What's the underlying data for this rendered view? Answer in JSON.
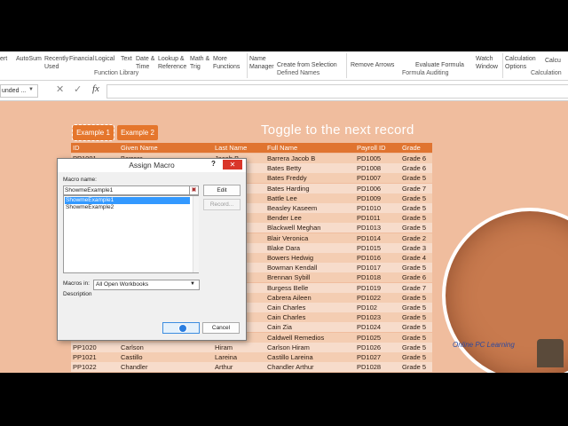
{
  "ribbon": {
    "items": [
      {
        "key": "left",
        "label": "ert"
      },
      {
        "key": "autosum",
        "label": "AutoSum"
      },
      {
        "key": "recently",
        "label": "Recently Used"
      },
      {
        "key": "financial",
        "label": "Financial"
      },
      {
        "key": "logical",
        "label": "Logical"
      },
      {
        "key": "text",
        "label": "Text"
      },
      {
        "key": "datetime",
        "label": "Date & Time"
      },
      {
        "key": "lookup",
        "label": "Lookup & Reference"
      },
      {
        "key": "math",
        "label": "Math & Trig"
      },
      {
        "key": "more",
        "label": "More Functions"
      },
      {
        "key": "namemgr",
        "label": "Name Manager"
      },
      {
        "key": "createsel",
        "label": "Create from Selection"
      },
      {
        "key": "removearrows",
        "label": "Remove Arrows"
      },
      {
        "key": "evalformula",
        "label": "Evaluate Formula"
      },
      {
        "key": "watch",
        "label": "Watch Window"
      },
      {
        "key": "calcopts",
        "label": "Calculation Options"
      },
      {
        "key": "calc",
        "label": "Calcu"
      }
    ],
    "groups": [
      "Function Library",
      "Defined Names",
      "Formula Auditing",
      "Calculation"
    ]
  },
  "formula_bar": {
    "name_box": "unded ...",
    "cancel_icon": "✕",
    "enter_icon": "✓",
    "fx": "fx"
  },
  "sheet": {
    "title": "Toggle to the next record",
    "button1": "Example 1",
    "button2": "Example 2",
    "headers": {
      "id": "ID",
      "given": "Given Name",
      "last": "Last Name",
      "full": "Full Name",
      "payroll": "Payroll ID",
      "grade": "Grade"
    },
    "rows": [
      {
        "id": "PP1001",
        "given": "Barrera",
        "last": "Jacob B",
        "full": "Barrera Jacob B",
        "payroll": "PD1005",
        "grade": "Grade 6"
      },
      {
        "id": "",
        "given": "",
        "last": "",
        "full": "Bates Betty",
        "payroll": "PD1008",
        "grade": "Grade 6"
      },
      {
        "id": "",
        "given": "",
        "last": "",
        "full": "Bates Freddy",
        "payroll": "PD1007",
        "grade": "Grade 5"
      },
      {
        "id": "",
        "given": "",
        "last": "",
        "full": "Bates Harding",
        "payroll": "PD1006",
        "grade": "Grade 7"
      },
      {
        "id": "",
        "given": "",
        "last": "",
        "full": "Battle Lee",
        "payroll": "PD1009",
        "grade": "Grade 5"
      },
      {
        "id": "",
        "given": "",
        "last": "",
        "full": "Beasley Kaseem",
        "payroll": "PD1010",
        "grade": "Grade 5"
      },
      {
        "id": "",
        "given": "",
        "last": "",
        "full": "Bender Lee",
        "payroll": "PD1011",
        "grade": "Grade 5"
      },
      {
        "id": "",
        "given": "",
        "last": "",
        "full": "Blackwell Meghan",
        "payroll": "PD1013",
        "grade": "Grade 5"
      },
      {
        "id": "",
        "given": "",
        "last": "",
        "full": "Blair Veronica",
        "payroll": "PD1014",
        "grade": "Grade 2"
      },
      {
        "id": "",
        "given": "",
        "last": "",
        "full": "Blake Dara",
        "payroll": "PD1015",
        "grade": "Grade 3"
      },
      {
        "id": "",
        "given": "",
        "last": "",
        "full": "Bowers Hedwig",
        "payroll": "PD1016",
        "grade": "Grade 4"
      },
      {
        "id": "",
        "given": "",
        "last": "",
        "full": "Bowman Kendall",
        "payroll": "PD1017",
        "grade": "Grade 5"
      },
      {
        "id": "",
        "given": "",
        "last": "",
        "full": "Brennan Sybill",
        "payroll": "PD1018",
        "grade": "Grade 6"
      },
      {
        "id": "",
        "given": "",
        "last": "",
        "full": "Burgess Belle",
        "payroll": "PD1019",
        "grade": "Grade 7"
      },
      {
        "id": "",
        "given": "",
        "last": "",
        "full": "Cabrera Aileen",
        "payroll": "PD1022",
        "grade": "Grade 5"
      },
      {
        "id": "",
        "given": "",
        "last": "",
        "full": "Cain Charles",
        "payroll": "PD102",
        "grade": "Grade 5"
      },
      {
        "id": "",
        "given": "",
        "last": "",
        "full": "Cain Charles",
        "payroll": "PD1023",
        "grade": "Grade 5"
      },
      {
        "id": "",
        "given": "",
        "last": "",
        "full": "Cain Zia",
        "payroll": "PD1024",
        "grade": "Grade 5"
      },
      {
        "id": "",
        "given": "",
        "last": "",
        "full": "Caldwell Remedios",
        "payroll": "PD1025",
        "grade": "Grade 5"
      },
      {
        "id": "PP1020",
        "given": "Carlson",
        "last": "Hiram",
        "full": "Carlson Hiram",
        "payroll": "PD1026",
        "grade": "Grade 5"
      },
      {
        "id": "PP1021",
        "given": "Castillo",
        "last": "Lareina",
        "full": "Castillo Lareina",
        "payroll": "PD1027",
        "grade": "Grade 5"
      },
      {
        "id": "PP1022",
        "given": "Chandler",
        "last": "Arthur",
        "full": "Chandler Arthur",
        "payroll": "PD1028",
        "grade": "Grade 5"
      }
    ],
    "watermark": "Online PC Learning"
  },
  "dialog": {
    "title": "Assign Macro",
    "help": "?",
    "close": "✕",
    "macro_name_label": "Macro name:",
    "macro_name_value": "ShowmeExample1",
    "macros": [
      "ShowmeExample1",
      "ShowmeExample2"
    ],
    "edit": "Edit",
    "record": "Record...",
    "macros_in_label": "Macros in:",
    "macros_in_value": "All Open Workbooks",
    "description_label": "Description",
    "ok": "OK",
    "cancel": "Cancel"
  },
  "colors": {
    "accent": "#e07430",
    "sheet_bg": "#f0bd9e",
    "selection": "#3399ff",
    "close": "#d9362a"
  }
}
